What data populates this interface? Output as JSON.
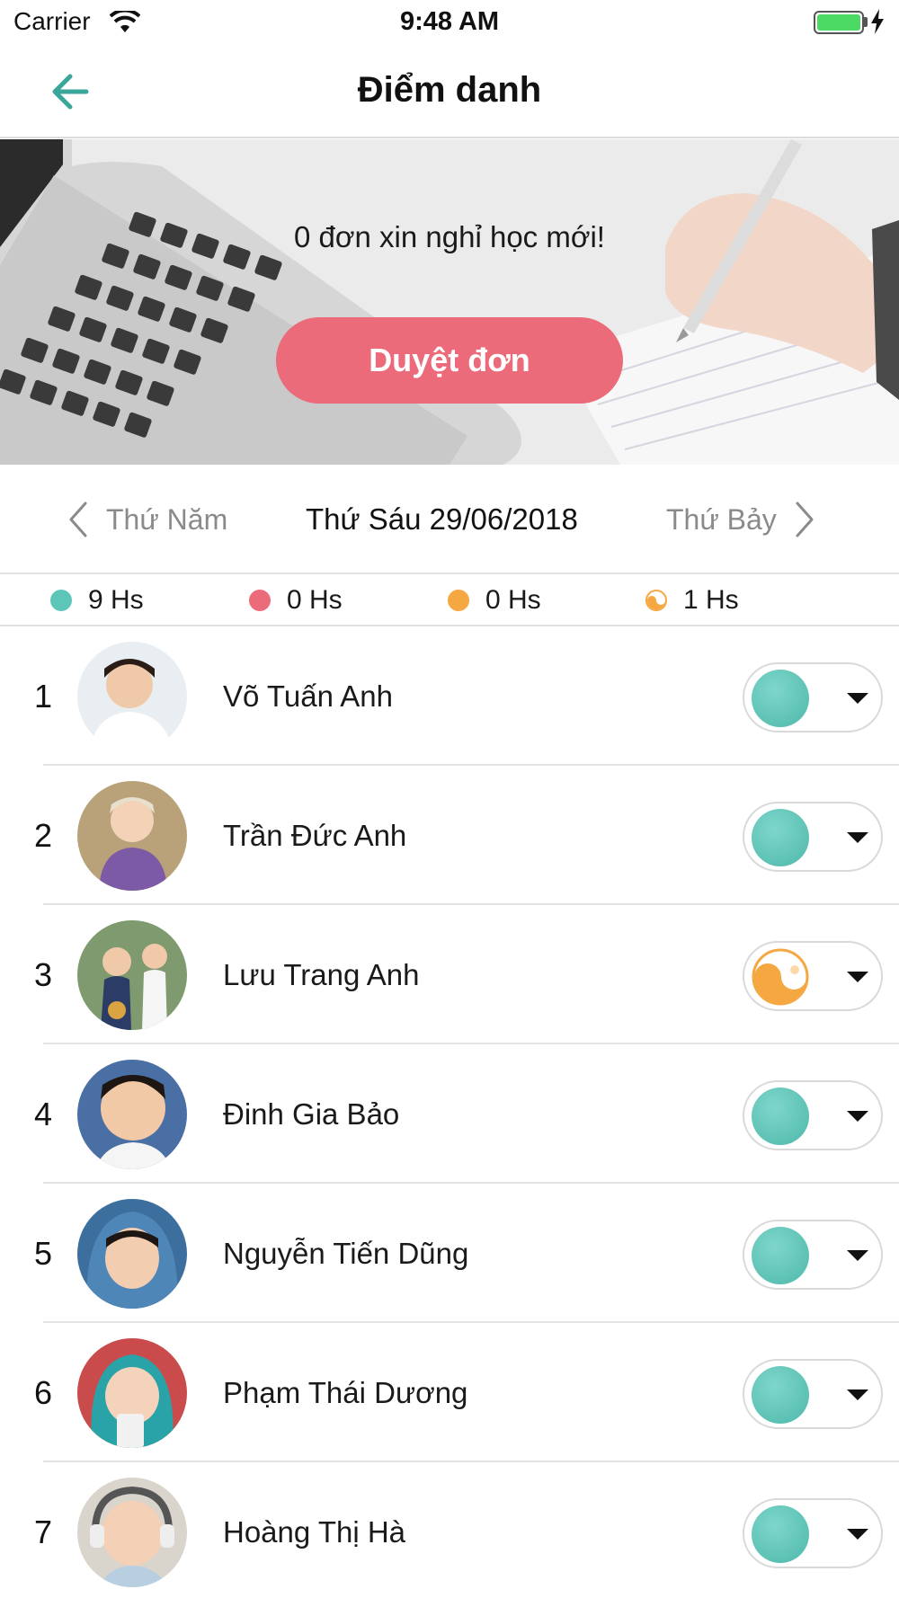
{
  "status_bar": {
    "carrier": "Carrier",
    "time": "9:48 AM",
    "icons": [
      "wifi-icon",
      "battery-icon",
      "charging-bolt-icon"
    ]
  },
  "nav": {
    "title": "Điểm danh",
    "back_icon": "arrow-left-icon",
    "accent_color": "#3aa69a"
  },
  "banner": {
    "message": "0 đơn xin nghỉ học mới!",
    "button_label": "Duyệt đơn",
    "button_color": "#ec6b7a"
  },
  "date_selector": {
    "prev_label": "Thứ Năm",
    "current_label": "Thứ Sáu 29/06/2018",
    "next_label": "Thứ Bảy"
  },
  "summary": [
    {
      "label": "9 Hs",
      "color": "#5cc6b9",
      "kind": "present"
    },
    {
      "label": "0 Hs",
      "color": "#ec6b7a",
      "kind": "absent"
    },
    {
      "label": "0 Hs",
      "color": "#f5a742",
      "kind": "late"
    },
    {
      "label": "1 Hs",
      "color": "#f5a742",
      "kind": "excused"
    }
  ],
  "students": [
    {
      "index": "1",
      "name": "Võ Tuấn Anh",
      "status": "present"
    },
    {
      "index": "2",
      "name": "Trần Đức Anh",
      "status": "present"
    },
    {
      "index": "3",
      "name": "Lưu Trang Anh",
      "status": "excused"
    },
    {
      "index": "4",
      "name": "Đinh Gia Bảo",
      "status": "present"
    },
    {
      "index": "5",
      "name": "Nguyễn Tiến Dũng",
      "status": "present"
    },
    {
      "index": "6",
      "name": "Phạm Thái Dương",
      "status": "present"
    },
    {
      "index": "7",
      "name": "Hoàng Thị Hà",
      "status": "present"
    }
  ]
}
